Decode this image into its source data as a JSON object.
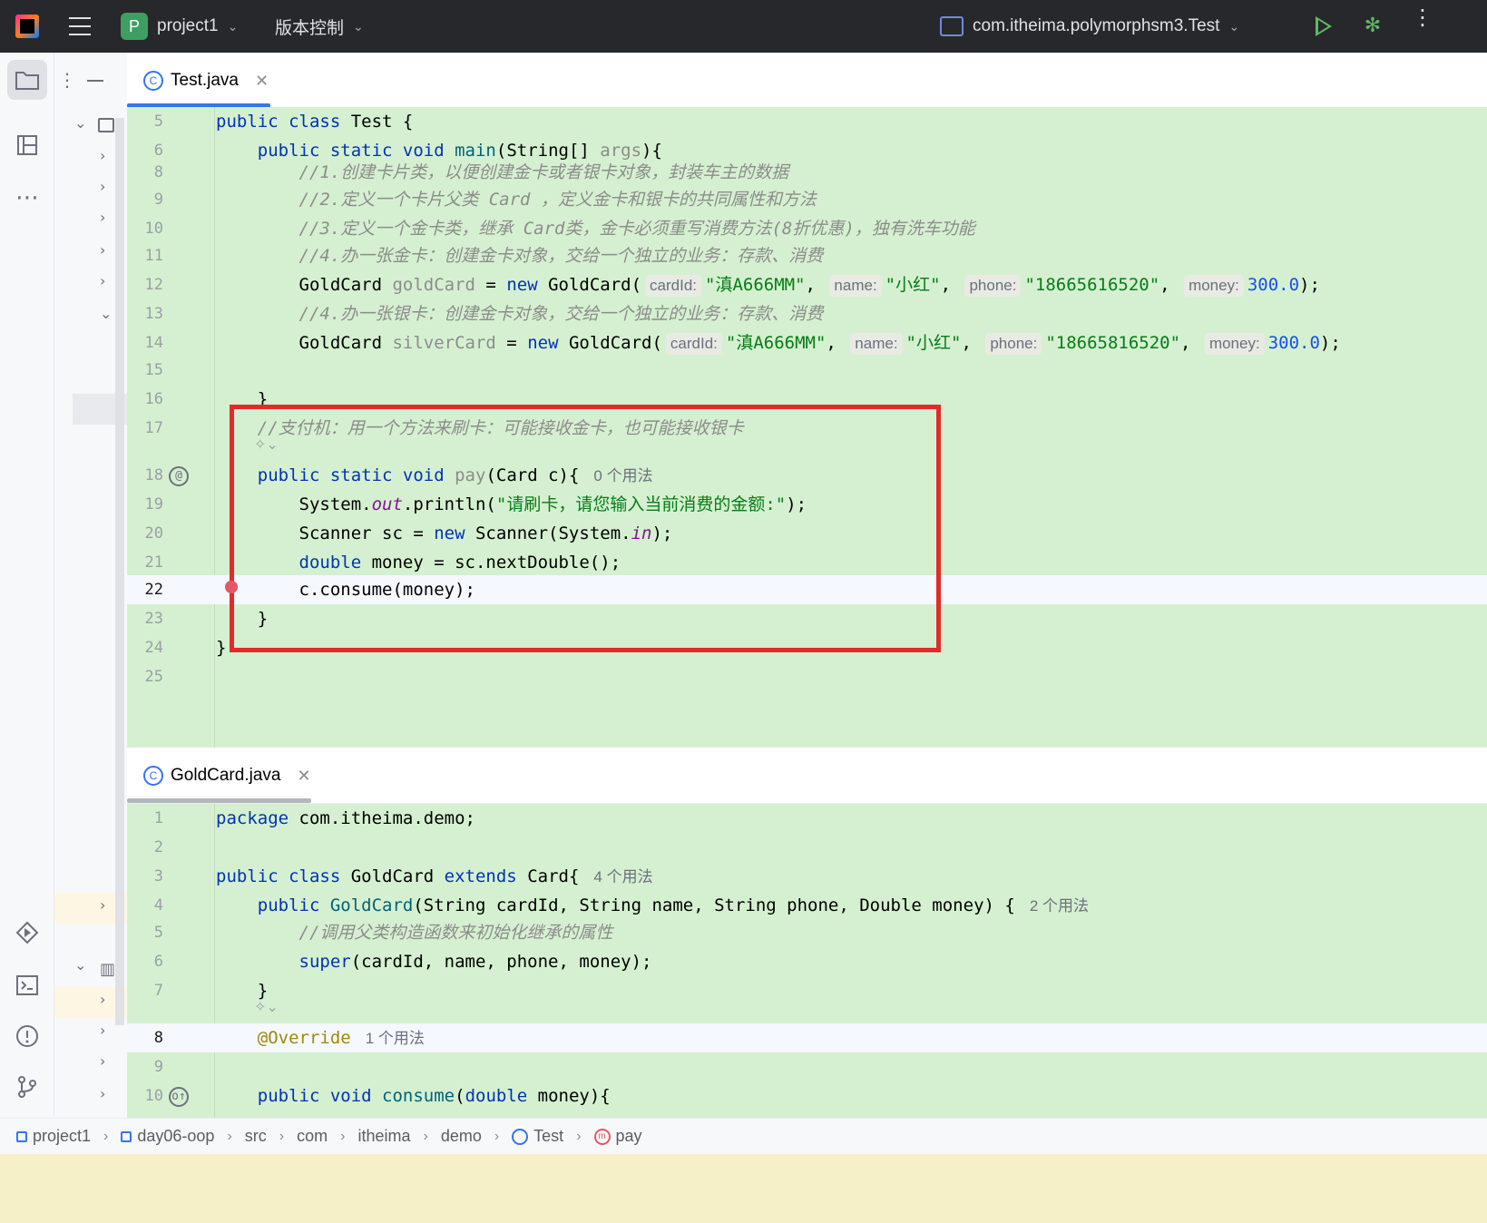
{
  "titlebar": {
    "project_badge": "P",
    "project_name": "project1",
    "vcs_label": "版本控制",
    "run_config": "com.itheima.polymorphsm3.Test"
  },
  "left_strip": {
    "icons": [
      "folder-icon",
      "structure-icon",
      "more-icon",
      "run-icon",
      "terminal-icon",
      "problems-icon",
      "git-icon"
    ]
  },
  "tabs": {
    "top": {
      "label": "Test.java"
    },
    "bottom": {
      "label": "GoldCard.java"
    }
  },
  "test_java": {
    "lines": [
      {
        "n": "5",
        "parts": [
          [
            "kw",
            "public class "
          ],
          [
            "",
            "Test {"
          ]
        ]
      },
      {
        "n": "6",
        "parts": [
          [
            "",
            "    "
          ],
          [
            "kw",
            "public static void "
          ],
          [
            "fn",
            "main"
          ],
          [
            "",
            "(String[] "
          ],
          [
            "var-unused",
            "args"
          ],
          [
            "",
            "){"
          ]
        ]
      },
      {
        "n": "8",
        "parts": [
          [
            "",
            "        "
          ],
          [
            "com",
            "//1.创建卡片类，以便创建金卡或者银卡对象，封装车主的数据"
          ]
        ]
      },
      {
        "n": "9",
        "parts": [
          [
            "",
            "        "
          ],
          [
            "com",
            "//2.定义一个卡片父类 Card ，定义金卡和银卡的共同属性和方法"
          ]
        ]
      },
      {
        "n": "10",
        "parts": [
          [
            "",
            "        "
          ],
          [
            "com",
            "//3.定义一个金卡类，继承 Card类，金卡必须重写消费方法(8折优惠)，独有洗车功能"
          ]
        ]
      },
      {
        "n": "11",
        "parts": [
          [
            "",
            "        "
          ],
          [
            "com",
            "//4.办一张金卡：创建金卡对象，交给一个独立的业务：存款、消费"
          ]
        ]
      },
      {
        "n": "12",
        "parts": [
          [
            "",
            "        GoldCard "
          ],
          [
            "var-unused",
            "goldCard"
          ],
          [
            "",
            " = "
          ],
          [
            "kw",
            "new "
          ],
          [
            "",
            "GoldCard("
          ],
          [
            "hint",
            "cardId:"
          ],
          [
            "str",
            "\"滇A666MM\""
          ],
          [
            "",
            ", "
          ],
          [
            "hint",
            "name:"
          ],
          [
            "str",
            "\"小红\""
          ],
          [
            "",
            ", "
          ],
          [
            "hint",
            "phone:"
          ],
          [
            "str",
            "\"18665616520\""
          ],
          [
            "",
            ", "
          ],
          [
            "hint",
            "money:"
          ],
          [
            "num",
            "300.0"
          ],
          [
            "",
            ");"
          ]
        ]
      },
      {
        "n": "13",
        "parts": [
          [
            "",
            "        "
          ],
          [
            "com",
            "//4.办一张银卡：创建金卡对象，交给一个独立的业务：存款、消费"
          ]
        ]
      },
      {
        "n": "14",
        "parts": [
          [
            "",
            "        GoldCard "
          ],
          [
            "var-unused",
            "silverCard"
          ],
          [
            "",
            " = "
          ],
          [
            "kw",
            "new "
          ],
          [
            "",
            "GoldCard("
          ],
          [
            "hint",
            "cardId:"
          ],
          [
            "str",
            "\"滇A666MM\""
          ],
          [
            "",
            ", "
          ],
          [
            "hint",
            "name:"
          ],
          [
            "str",
            "\"小红\""
          ],
          [
            "",
            ", "
          ],
          [
            "hint",
            "phone:"
          ],
          [
            "str",
            "\"18665816520\""
          ],
          [
            "",
            ", "
          ],
          [
            "hint",
            "money:"
          ],
          [
            "num",
            "300.0"
          ],
          [
            "",
            ");"
          ]
        ]
      },
      {
        "n": "15",
        "parts": []
      },
      {
        "n": "16",
        "parts": [
          [
            "",
            "    }"
          ]
        ]
      },
      {
        "n": "17",
        "parts": [
          [
            "",
            "    "
          ],
          [
            "com",
            "//支付机：用一个方法来刷卡：可能接收金卡，也可能接收银卡"
          ]
        ]
      },
      {
        "n": "18",
        "parts": [
          [
            "",
            "    "
          ],
          [
            "kw",
            "public static void "
          ],
          [
            "var-unused",
            "pay"
          ],
          [
            "",
            "(Card c){"
          ],
          [
            "usage",
            "0 个用法"
          ]
        ]
      },
      {
        "n": "19",
        "parts": [
          [
            "",
            "        System."
          ],
          [
            "fld",
            "out"
          ],
          [
            "",
            ".println("
          ],
          [
            "str",
            "\"请刷卡，请您输入当前消费的金额:\""
          ],
          [
            "",
            ");"
          ]
        ]
      },
      {
        "n": "20",
        "parts": [
          [
            "",
            "        Scanner sc = "
          ],
          [
            "kw",
            "new "
          ],
          [
            "",
            "Scanner(System."
          ],
          [
            "fld",
            "in"
          ],
          [
            "",
            ");"
          ]
        ]
      },
      {
        "n": "21",
        "parts": [
          [
            "",
            "        "
          ],
          [
            "kw",
            "double "
          ],
          [
            "",
            "money = sc.nextDouble();"
          ]
        ]
      },
      {
        "n": "22",
        "parts": [
          [
            "",
            "        c.consume(money);"
          ]
        ]
      },
      {
        "n": "23",
        "parts": [
          [
            "",
            "    }"
          ]
        ]
      },
      {
        "n": "24",
        "parts": [
          [
            "",
            "}"
          ]
        ]
      },
      {
        "n": "25",
        "parts": []
      }
    ]
  },
  "goldcard_java": {
    "lines": [
      {
        "n": "1",
        "parts": [
          [
            "kw",
            "package "
          ],
          [
            "",
            "com.itheima.demo;"
          ]
        ]
      },
      {
        "n": "2",
        "parts": []
      },
      {
        "n": "3",
        "parts": [
          [
            "kw",
            "public class "
          ],
          [
            "",
            "GoldCard "
          ],
          [
            "kw",
            "extends "
          ],
          [
            "",
            "Card{"
          ],
          [
            "usage",
            "4 个用法"
          ]
        ]
      },
      {
        "n": "4",
        "parts": [
          [
            "",
            "    "
          ],
          [
            "kw",
            "public "
          ],
          [
            "fn",
            "GoldCard"
          ],
          [
            "",
            "(String cardId, String name, String phone, Double money) {"
          ],
          [
            "usage",
            "2 个用法"
          ]
        ]
      },
      {
        "n": "5",
        "parts": [
          [
            "",
            "        "
          ],
          [
            "com",
            "//调用父类构造函数来初始化继承的属性"
          ]
        ]
      },
      {
        "n": "6",
        "parts": [
          [
            "",
            "        "
          ],
          [
            "kw",
            "super"
          ],
          [
            "",
            "(cardId, name, phone, money);"
          ]
        ]
      },
      {
        "n": "7",
        "parts": [
          [
            "",
            "    }"
          ]
        ]
      },
      {
        "n": "8",
        "parts": [
          [
            "",
            "    "
          ],
          [
            "ann",
            "@Override"
          ],
          [
            "usage",
            "1 个用法"
          ]
        ]
      },
      {
        "n": "9",
        "parts": []
      },
      {
        "n": "10",
        "parts": [
          [
            "",
            "    "
          ],
          [
            "kw",
            "public void "
          ],
          [
            "fn",
            "consume"
          ],
          [
            "",
            "("
          ],
          [
            "kw",
            "double "
          ],
          [
            "",
            "money){"
          ]
        ]
      }
    ]
  },
  "gutter": {
    "line18_icon": "@",
    "line10_icon": "o↑"
  },
  "breadcrumb": {
    "items": [
      "project1",
      "day06-oop",
      "src",
      "com",
      "itheima",
      "demo",
      "Test",
      "pay"
    ]
  }
}
